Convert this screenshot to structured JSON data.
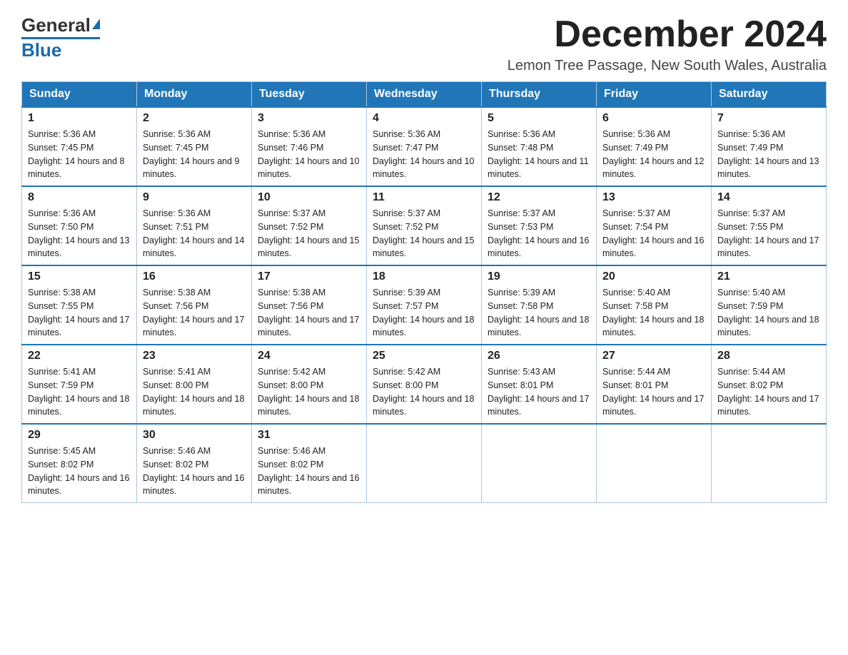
{
  "logo": {
    "general": "General",
    "blue": "Blue",
    "tagline": "GeneralBlue"
  },
  "header": {
    "month_year": "December 2024",
    "location": "Lemon Tree Passage, New South Wales, Australia"
  },
  "weekdays": [
    "Sunday",
    "Monday",
    "Tuesday",
    "Wednesday",
    "Thursday",
    "Friday",
    "Saturday"
  ],
  "weeks": [
    [
      {
        "day": "1",
        "sunrise": "5:36 AM",
        "sunset": "7:45 PM",
        "daylight": "14 hours and 8 minutes."
      },
      {
        "day": "2",
        "sunrise": "5:36 AM",
        "sunset": "7:45 PM",
        "daylight": "14 hours and 9 minutes."
      },
      {
        "day": "3",
        "sunrise": "5:36 AM",
        "sunset": "7:46 PM",
        "daylight": "14 hours and 10 minutes."
      },
      {
        "day": "4",
        "sunrise": "5:36 AM",
        "sunset": "7:47 PM",
        "daylight": "14 hours and 10 minutes."
      },
      {
        "day": "5",
        "sunrise": "5:36 AM",
        "sunset": "7:48 PM",
        "daylight": "14 hours and 11 minutes."
      },
      {
        "day": "6",
        "sunrise": "5:36 AM",
        "sunset": "7:49 PM",
        "daylight": "14 hours and 12 minutes."
      },
      {
        "day": "7",
        "sunrise": "5:36 AM",
        "sunset": "7:49 PM",
        "daylight": "14 hours and 13 minutes."
      }
    ],
    [
      {
        "day": "8",
        "sunrise": "5:36 AM",
        "sunset": "7:50 PM",
        "daylight": "14 hours and 13 minutes."
      },
      {
        "day": "9",
        "sunrise": "5:36 AM",
        "sunset": "7:51 PM",
        "daylight": "14 hours and 14 minutes."
      },
      {
        "day": "10",
        "sunrise": "5:37 AM",
        "sunset": "7:52 PM",
        "daylight": "14 hours and 15 minutes."
      },
      {
        "day": "11",
        "sunrise": "5:37 AM",
        "sunset": "7:52 PM",
        "daylight": "14 hours and 15 minutes."
      },
      {
        "day": "12",
        "sunrise": "5:37 AM",
        "sunset": "7:53 PM",
        "daylight": "14 hours and 16 minutes."
      },
      {
        "day": "13",
        "sunrise": "5:37 AM",
        "sunset": "7:54 PM",
        "daylight": "14 hours and 16 minutes."
      },
      {
        "day": "14",
        "sunrise": "5:37 AM",
        "sunset": "7:55 PM",
        "daylight": "14 hours and 17 minutes."
      }
    ],
    [
      {
        "day": "15",
        "sunrise": "5:38 AM",
        "sunset": "7:55 PM",
        "daylight": "14 hours and 17 minutes."
      },
      {
        "day": "16",
        "sunrise": "5:38 AM",
        "sunset": "7:56 PM",
        "daylight": "14 hours and 17 minutes."
      },
      {
        "day": "17",
        "sunrise": "5:38 AM",
        "sunset": "7:56 PM",
        "daylight": "14 hours and 17 minutes."
      },
      {
        "day": "18",
        "sunrise": "5:39 AM",
        "sunset": "7:57 PM",
        "daylight": "14 hours and 18 minutes."
      },
      {
        "day": "19",
        "sunrise": "5:39 AM",
        "sunset": "7:58 PM",
        "daylight": "14 hours and 18 minutes."
      },
      {
        "day": "20",
        "sunrise": "5:40 AM",
        "sunset": "7:58 PM",
        "daylight": "14 hours and 18 minutes."
      },
      {
        "day": "21",
        "sunrise": "5:40 AM",
        "sunset": "7:59 PM",
        "daylight": "14 hours and 18 minutes."
      }
    ],
    [
      {
        "day": "22",
        "sunrise": "5:41 AM",
        "sunset": "7:59 PM",
        "daylight": "14 hours and 18 minutes."
      },
      {
        "day": "23",
        "sunrise": "5:41 AM",
        "sunset": "8:00 PM",
        "daylight": "14 hours and 18 minutes."
      },
      {
        "day": "24",
        "sunrise": "5:42 AM",
        "sunset": "8:00 PM",
        "daylight": "14 hours and 18 minutes."
      },
      {
        "day": "25",
        "sunrise": "5:42 AM",
        "sunset": "8:00 PM",
        "daylight": "14 hours and 18 minutes."
      },
      {
        "day": "26",
        "sunrise": "5:43 AM",
        "sunset": "8:01 PM",
        "daylight": "14 hours and 17 minutes."
      },
      {
        "day": "27",
        "sunrise": "5:44 AM",
        "sunset": "8:01 PM",
        "daylight": "14 hours and 17 minutes."
      },
      {
        "day": "28",
        "sunrise": "5:44 AM",
        "sunset": "8:02 PM",
        "daylight": "14 hours and 17 minutes."
      }
    ],
    [
      {
        "day": "29",
        "sunrise": "5:45 AM",
        "sunset": "8:02 PM",
        "daylight": "14 hours and 16 minutes."
      },
      {
        "day": "30",
        "sunrise": "5:46 AM",
        "sunset": "8:02 PM",
        "daylight": "14 hours and 16 minutes."
      },
      {
        "day": "31",
        "sunrise": "5:46 AM",
        "sunset": "8:02 PM",
        "daylight": "14 hours and 16 minutes."
      },
      null,
      null,
      null,
      null
    ]
  ]
}
